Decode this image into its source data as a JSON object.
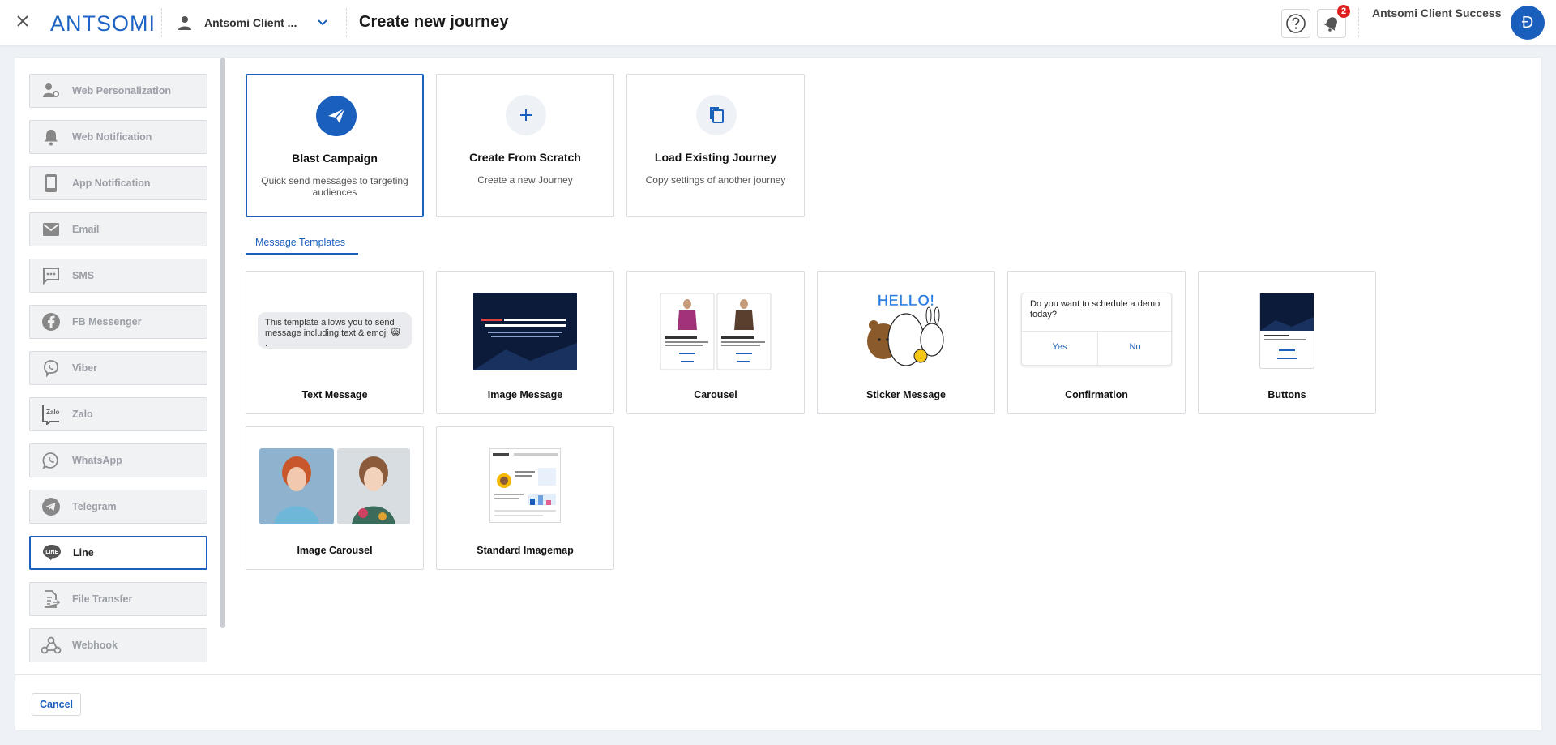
{
  "header": {
    "logo_text": "ANTSOMI",
    "account_name": "Antsomi Client ...",
    "page_title": "Create new journey",
    "notification_count": "2",
    "user_name": "Antsomi Client Success",
    "avatar_initial": "Đ"
  },
  "sidebar": {
    "items": [
      {
        "label": "Web Personalization",
        "icon": "user-gear-icon"
      },
      {
        "label": "Web Notification",
        "icon": "bell-icon"
      },
      {
        "label": "App Notification",
        "icon": "mobile-icon"
      },
      {
        "label": "Email",
        "icon": "mail-icon"
      },
      {
        "label": "SMS",
        "icon": "chat-icon"
      },
      {
        "label": "FB Messenger",
        "icon": "facebook-icon"
      },
      {
        "label": "Viber",
        "icon": "viber-icon"
      },
      {
        "label": "Zalo",
        "icon": "zalo-icon"
      },
      {
        "label": "WhatsApp",
        "icon": "whatsapp-icon"
      },
      {
        "label": "Telegram",
        "icon": "telegram-icon"
      },
      {
        "label": "Line",
        "icon": "line-icon",
        "icon_text": "LINE",
        "active": true
      },
      {
        "label": "File Transfer",
        "icon": "file-transfer-icon"
      },
      {
        "label": "Webhook",
        "icon": "webhook-icon"
      }
    ]
  },
  "options": [
    {
      "title": "Blast Campaign",
      "subtitle": "Quick send messages to targeting audiences",
      "icon": "send-icon",
      "selected": true
    },
    {
      "title": "Create From Scratch",
      "subtitle": "Create a new Journey",
      "icon": "plus-icon"
    },
    {
      "title": "Load Existing Journey",
      "subtitle": "Copy settings of another journey",
      "icon": "copy-icon"
    }
  ],
  "tabs": {
    "message_templates": "Message Templates"
  },
  "templates": [
    {
      "label": "Text Message",
      "preview_text": "This template allows you to send message including text & emoji 😹 ."
    },
    {
      "label": "Image Message"
    },
    {
      "label": "Carousel"
    },
    {
      "label": "Sticker Message",
      "sticker_text": "HELLO!"
    },
    {
      "label": "Confirmation",
      "question": "Do you want to schedule a demo today?",
      "yes": "Yes",
      "no": "No"
    },
    {
      "label": "Buttons"
    },
    {
      "label": "Image Carousel"
    },
    {
      "label": "Standard Imagemap"
    }
  ],
  "footer": {
    "cancel_label": "Cancel"
  },
  "colors": {
    "primary": "#1b5fbd",
    "badge": "#e02020"
  }
}
